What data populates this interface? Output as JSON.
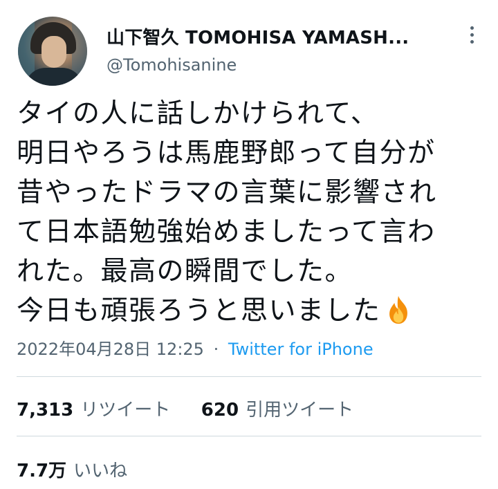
{
  "tweet": {
    "display_name": "山下智久 TOMOHISA YAMASH...",
    "handle": "@Tomohisanine",
    "lines": [
      "タイの人に話しかけられて、",
      "明日やろうは馬鹿野郎って自分が",
      "昔やったドラマの言葉に影響され",
      "て日本語勉強始めましたって言わ",
      "れた。最高の瞬間でした。",
      "今日も頑張ろうと思いました"
    ],
    "emoji": "fire-emoji",
    "date": "2022年04月28日 12:25",
    "separator": "·",
    "source": "Twitter for iPhone"
  },
  "stats": {
    "retweets_count": "7,313",
    "retweets_label": "リツイート",
    "quotes_count": "620",
    "quotes_label": "引用ツイート",
    "likes_count": "7.7万",
    "likes_label": "いいね"
  },
  "colors": {
    "text": "#0f1419",
    "secondary": "#536471",
    "link": "#1d9bf0",
    "divider": "#cfd9de"
  }
}
